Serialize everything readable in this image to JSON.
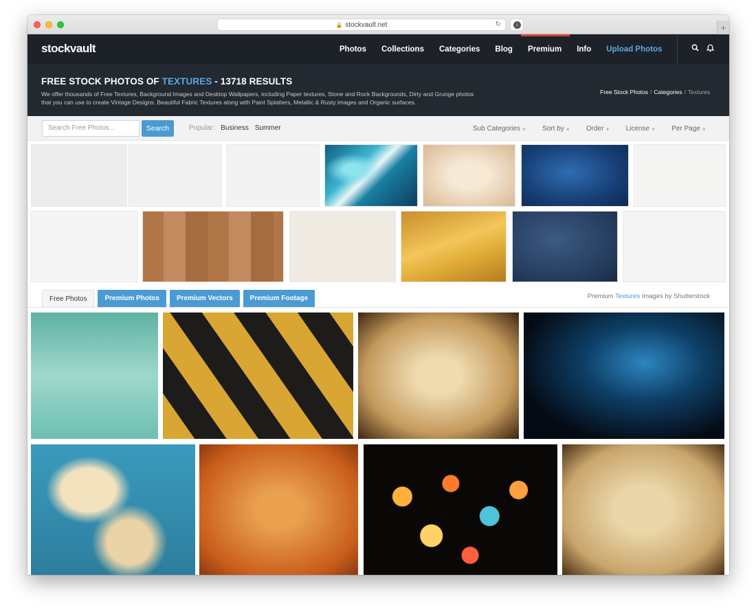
{
  "browser": {
    "url": "stockvault.net",
    "lock_icon": "lock-icon",
    "reload_icon": "reload-icon",
    "download_icon": "download-icon",
    "new_tab_label": "+"
  },
  "nav": {
    "logo": "stockvault",
    "links": [
      "Photos",
      "Collections",
      "Categories",
      "Blog",
      "Premium",
      "Info",
      "Upload Photos"
    ],
    "accent": "#5aa9e6",
    "premium_indicator_color": "#d9423a"
  },
  "hero": {
    "title_prefix": "FREE STOCK PHOTOS OF ",
    "title_highlight": "TEXTURES",
    "title_suffix": " - 13718 RESULTS",
    "description": "We offer thousands of Free Textures, Background Images and Desktop Wallpapers, including Paper textures, Stone and Rock Backgrounds, Dirty and Grunge photos that you can use to create Vintage Designs. Beautiful Fabric Textures along with Paint Splatters, Metallic & Rusty images and Organic surfaces.",
    "breadcrumbs": [
      "Free Stock Photos",
      "Categories",
      "Textures"
    ],
    "breadcrumb_separator": "/"
  },
  "search": {
    "placeholder": "Search Free Photos...",
    "button": "Search",
    "popular_label": "Popular:",
    "popular_tags": [
      "Business",
      "Summer"
    ]
  },
  "filters": [
    "Sub Categories",
    "Sort by",
    "Order",
    "License",
    "Per Page"
  ],
  "tabs": [
    "Free Photos",
    "Premium Photos",
    "Premium Vectors",
    "Premium Footage"
  ],
  "shutterstock": {
    "prefix": "Premium ",
    "highlight": "Textures",
    "suffix": " Images by Shutterstock"
  },
  "row1_thumbs": [
    {
      "name": "white-paper-texture",
      "color": "#ececec"
    },
    {
      "name": "light-gray-texture",
      "color": "#f1f1f1"
    },
    {
      "name": "white-speckled-texture",
      "color": "#f3f3f3"
    },
    {
      "name": "blue-marble-fluid-art",
      "color": "#2a8fb0"
    },
    {
      "name": "beige-vintage-paper",
      "color": "#ecd8c0"
    },
    {
      "name": "dark-blue-grunge-wall",
      "color": "#1c4f8f"
    },
    {
      "name": "off-white-paper",
      "color": "#f4f4f2"
    }
  ],
  "row2_thumbs": [
    {
      "name": "white-plaster-texture",
      "color": "#f5f5f5"
    },
    {
      "name": "wood-planks-texture",
      "color": "#b57c52"
    },
    {
      "name": "cream-paper-texture",
      "color": "#f0ebe2"
    },
    {
      "name": "gold-foil-texture",
      "color": "#d9a93a"
    },
    {
      "name": "navy-concrete-texture",
      "color": "#2c4466"
    },
    {
      "name": "white-linen-texture",
      "color": "#f4f4f4"
    }
  ],
  "premium_row1": [
    {
      "name": "tree-reflection-teal",
      "color": "#7fc4b8"
    },
    {
      "name": "yellow-black-hazard-stripes",
      "color": "#d7a22f"
    },
    {
      "name": "grunge-parchment-frame",
      "color": "#c5a064"
    },
    {
      "name": "blue-smoke-on-black",
      "color": "#0d3f66"
    }
  ],
  "premium_row2": [
    {
      "name": "grunge-sky-clouds",
      "color": "#3c97b3"
    },
    {
      "name": "orange-grunge-texture",
      "color": "#d27a2e"
    },
    {
      "name": "bokeh-lights",
      "color": "#e0782a"
    },
    {
      "name": "grunge-old-paper",
      "color": "#cfb383"
    }
  ]
}
